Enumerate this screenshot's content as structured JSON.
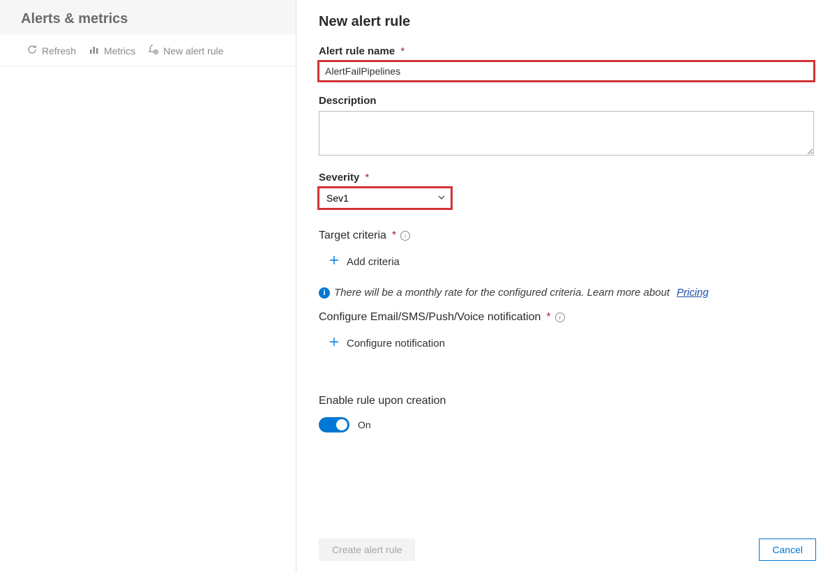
{
  "left": {
    "title": "Alerts & metrics",
    "toolbar": {
      "refresh": "Refresh",
      "metrics": "Metrics",
      "new_alert_rule": "New alert rule"
    }
  },
  "right": {
    "title": "New alert rule",
    "fields": {
      "name_label": "Alert rule name",
      "name_value": "AlertFailPipelines",
      "description_label": "Description",
      "description_value": "",
      "severity_label": "Severity",
      "severity_value": "Sev1",
      "target_label": "Target criteria",
      "add_criteria": "Add criteria",
      "rate_notice": "There will be a monthly rate for the configured criteria. Learn more about",
      "pricing_link": "Pricing",
      "notif_label": "Configure Email/SMS/Push/Voice notification",
      "configure_notification": "Configure notification",
      "enable_label": "Enable rule upon creation",
      "toggle_value": "On"
    },
    "footer": {
      "create": "Create alert rule",
      "cancel": "Cancel"
    }
  }
}
